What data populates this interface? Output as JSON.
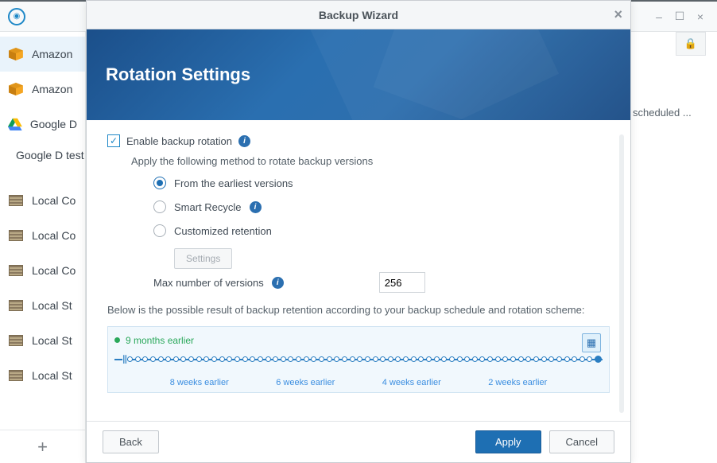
{
  "window": {
    "minimize": "–",
    "maximize": "☐",
    "close": "×"
  },
  "sidebar": {
    "items": [
      {
        "label": "Amazon",
        "icon": "box"
      },
      {
        "label": "Amazon",
        "icon": "box"
      },
      {
        "label": "Google D",
        "icon": "gdrive"
      },
      {
        "label": "Google D test",
        "icon": "gdrive"
      },
      {
        "label": "Local Co",
        "icon": "server"
      },
      {
        "label": "Local Co",
        "icon": "server"
      },
      {
        "label": "Local Co",
        "icon": "server"
      },
      {
        "label": "Local St",
        "icon": "server"
      },
      {
        "label": "Local St",
        "icon": "server"
      },
      {
        "label": "Local St",
        "icon": "server"
      }
    ],
    "add": "+"
  },
  "panel": {
    "scheduled_text": "scheduled ..."
  },
  "wizard": {
    "title": "Backup Wizard",
    "heading": "Rotation Settings",
    "enable_label": "Enable backup rotation",
    "apply_text": "Apply the following method to rotate backup versions",
    "options": {
      "earliest": "From the earliest versions",
      "smart": "Smart Recycle",
      "custom": "Customized retention"
    },
    "settings_btn": "Settings",
    "max_label": "Max number of versions",
    "max_value": "256",
    "desc": "Below is the possible result of backup retention according to your backup schedule and rotation scheme:",
    "timeline": {
      "earliest_label": "9 months earlier",
      "ticks": [
        "8 weeks earlier",
        "6 weeks earlier",
        "4 weeks earlier",
        "2 weeks earlier"
      ]
    },
    "footer": {
      "back": "Back",
      "apply": "Apply",
      "cancel": "Cancel"
    }
  }
}
